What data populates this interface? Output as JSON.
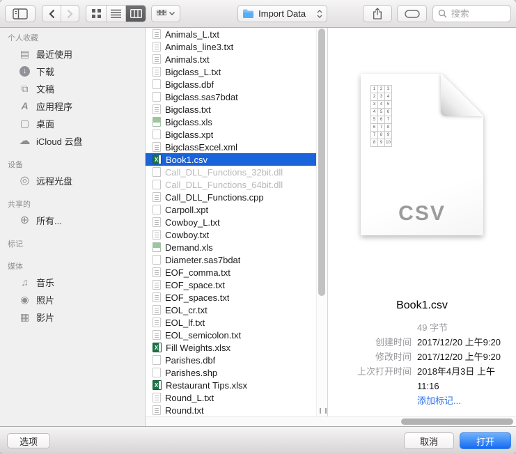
{
  "toolbar": {
    "folder_dropdown": {
      "label": "Import Data"
    },
    "search": {
      "placeholder": "搜索"
    }
  },
  "sidebar": {
    "favorites": {
      "header": "个人收藏",
      "items": [
        {
          "icon": "recents-icon",
          "label": "最近使用"
        },
        {
          "icon": "download-icon",
          "label": "下载"
        },
        {
          "icon": "documents-icon",
          "label": "文稿"
        },
        {
          "icon": "applications-icon",
          "label": "应用程序"
        },
        {
          "icon": "desktop-icon",
          "label": "桌面"
        },
        {
          "icon": "icloud-icon",
          "label": "iCloud 云盘"
        }
      ]
    },
    "devices": {
      "header": "设备",
      "items": [
        {
          "icon": "disc-icon",
          "label": "远程光盘"
        }
      ]
    },
    "shared": {
      "header": "共享的",
      "items": [
        {
          "icon": "globe-icon",
          "label": "所有..."
        }
      ]
    },
    "tags": {
      "header": "标记",
      "items": []
    },
    "media": {
      "header": "媒体",
      "items": [
        {
          "icon": "music-icon",
          "label": "音乐"
        },
        {
          "icon": "photos-icon",
          "label": "照片"
        },
        {
          "icon": "movies-icon",
          "label": "影片"
        }
      ]
    }
  },
  "files": [
    {
      "name": "Animals_L.txt",
      "icon": "txt"
    },
    {
      "name": "Animals_line3.txt",
      "icon": "txt"
    },
    {
      "name": "Animals.txt",
      "icon": "txt"
    },
    {
      "name": "Bigclass_L.txt",
      "icon": "txt"
    },
    {
      "name": "Bigclass.dbf",
      "icon": "plain"
    },
    {
      "name": "Bigclass.sas7bdat",
      "icon": "plain"
    },
    {
      "name": "Bigclass.txt",
      "icon": "txt"
    },
    {
      "name": "Bigclass.xls",
      "icon": "xls"
    },
    {
      "name": "Bigclass.xpt",
      "icon": "plain"
    },
    {
      "name": "BigclassExcel.xml",
      "icon": "xml"
    },
    {
      "name": "Book1.csv",
      "icon": "excel",
      "state": "selected"
    },
    {
      "name": "Call_DLL_Functions_32bit.dll",
      "icon": "plain",
      "state": "disabled"
    },
    {
      "name": "Call_DLL_Functions_64bit.dll",
      "icon": "plain",
      "state": "disabled"
    },
    {
      "name": "Call_DLL_Functions.cpp",
      "icon": "txt"
    },
    {
      "name": "Carpoll.xpt",
      "icon": "plain"
    },
    {
      "name": "Cowboy_L.txt",
      "icon": "txt"
    },
    {
      "name": "Cowboy.txt",
      "icon": "txt"
    },
    {
      "name": "Demand.xls",
      "icon": "xls"
    },
    {
      "name": "Diameter.sas7bdat",
      "icon": "plain"
    },
    {
      "name": "EOF_comma.txt",
      "icon": "txt"
    },
    {
      "name": "EOF_space.txt",
      "icon": "txt"
    },
    {
      "name": "EOF_spaces.txt",
      "icon": "txt"
    },
    {
      "name": "EOL_cr.txt",
      "icon": "txt"
    },
    {
      "name": "EOL_lf.txt",
      "icon": "txt"
    },
    {
      "name": "EOL_semicolon.txt",
      "icon": "txt"
    },
    {
      "name": "Fill Weights.xlsx",
      "icon": "excel"
    },
    {
      "name": "Parishes.dbf",
      "icon": "plain"
    },
    {
      "name": "Parishes.shp",
      "icon": "plain"
    },
    {
      "name": "Restaurant Tips.xlsx",
      "icon": "excel"
    },
    {
      "name": "Round_L.txt",
      "icon": "txt"
    },
    {
      "name": "Round.txt",
      "icon": "txt"
    }
  ],
  "preview": {
    "file_name": "Book1.csv",
    "type_label": "CSV",
    "grid_cells": [
      "1",
      "2",
      "3",
      "2",
      "3",
      "4",
      "3",
      "4",
      "5",
      "4",
      "5",
      "6",
      "5",
      "6",
      "7",
      "6",
      "7",
      "8",
      "7",
      "8",
      "9",
      "8",
      "9",
      "10"
    ],
    "size": "49 字节",
    "details": [
      {
        "label": "创建时间",
        "value": "2017/12/20 上午9:20"
      },
      {
        "label": "修改时间",
        "value": "2017/12/20 上午9:20"
      },
      {
        "label": "上次打开时间",
        "value": "2018年4月3日 上午11:16"
      }
    ],
    "add_tags_label": "添加标记..."
  },
  "footer": {
    "options_label": "选项",
    "cancel_label": "取消",
    "open_label": "打开"
  },
  "colors": {
    "selection_blue": "#1a63d8",
    "open_button_blue": "#156af3",
    "link_blue": "#2e6fe8",
    "folder_blue": "#58aef7"
  }
}
